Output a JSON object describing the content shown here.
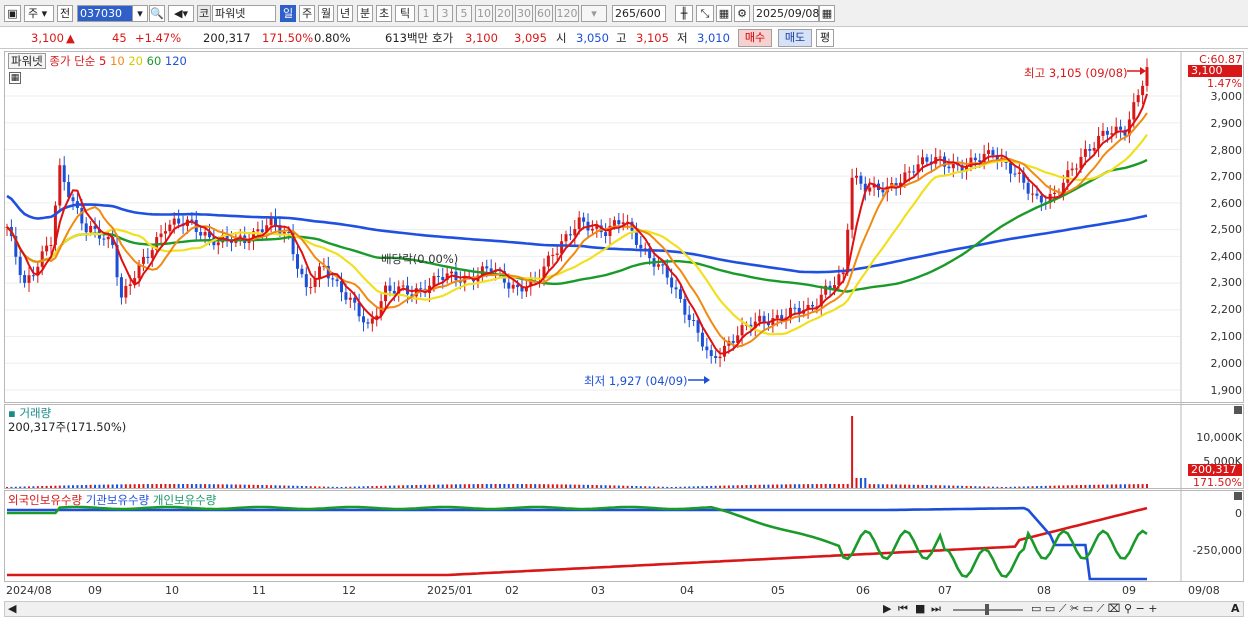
{
  "toolbar": {
    "market": "주",
    "prev_label": "전",
    "code": "037030",
    "name": "파워넷",
    "market_badge": "코",
    "periods": [
      "일",
      "주",
      "월",
      "년",
      "분",
      "초",
      "틱"
    ],
    "selected_period": "일",
    "intervals": [
      "1",
      "3",
      "5",
      "10",
      "20",
      "30",
      "60",
      "120"
    ],
    "count": "265",
    "count_total": "/600",
    "date": "2025/09/08"
  },
  "quote": {
    "price": "3,100",
    "up_arrow": "▲",
    "change": "45",
    "change_pct": "+1.47%",
    "volume": "200,317",
    "vol_ratio": "171.50%",
    "turnover": "0.80%",
    "amount": "613백만",
    "ask_label": "호가",
    "ask": "3,100",
    "bid": "3,095",
    "open_label": "시",
    "open": "3,050",
    "high_label": "고",
    "high": "3,105",
    "low_label": "저",
    "low": "3,010",
    "buy_label": "매수",
    "sell_label": "매도",
    "eval_label": "평"
  },
  "price_pane": {
    "title": "파워넷",
    "ma_label": "종가 단순",
    "ma5": "5",
    "ma10": "10",
    "ma20": "20",
    "ma60": "60",
    "ma120": "120",
    "max_annotation": "최고 3,105 (09/08)",
    "min_annotation": "최저 1,927 (04/09)",
    "dividend_annotation": "배당락(0.00%)",
    "axis_top": "C:60.87",
    "last_price": "3,100",
    "last_pct": "1.47%",
    "yticks": [
      "3,000",
      "2,900",
      "2,800",
      "2,700",
      "2,600",
      "2,500",
      "2,400",
      "2,300",
      "2,200",
      "2,100",
      "2,000",
      "1,900"
    ]
  },
  "volume_pane": {
    "title": "거래량",
    "value": "200,317주(171.50%)",
    "yticks": [
      "10,000K",
      "5,000K"
    ],
    "last_value": "200,317",
    "last_pct": "171.50%"
  },
  "holdings_pane": {
    "foreign_label": "외국인보유수량",
    "inst_label": "기관보유수량",
    "indiv_label": "개인보유수량",
    "yticks": [
      "0",
      "-250,000"
    ]
  },
  "x_axis": [
    "2024/08",
    "09",
    "10",
    "11",
    "12",
    "2025/01",
    "02",
    "03",
    "04",
    "05",
    "06",
    "07",
    "08",
    "09",
    "09/08"
  ],
  "colors": {
    "up": "#d81818",
    "down": "#1c4fd8",
    "ma5": "#e01010",
    "ma10": "#f08a10",
    "ma20": "#f0e020",
    "ma60": "#1a9a2a",
    "ma120": "#2050e0",
    "accent": "#2f5fc8"
  }
}
